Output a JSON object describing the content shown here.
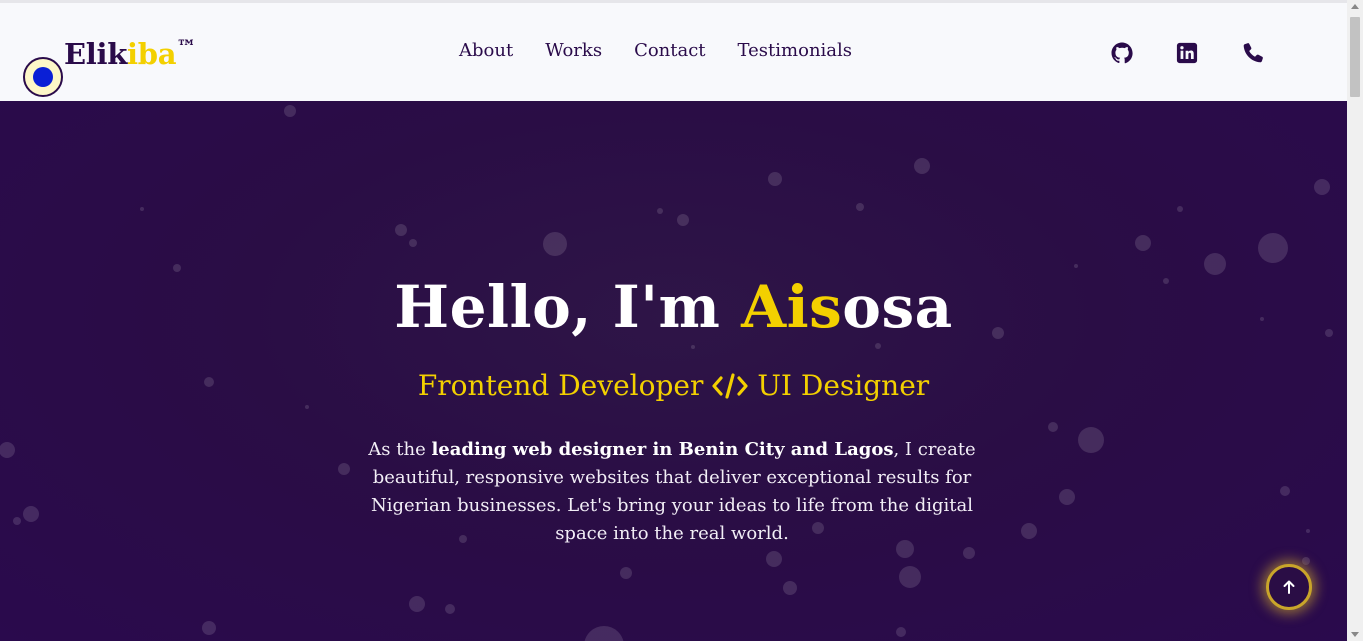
{
  "brand": {
    "name_part1": "Elik",
    "name_accent": "iba",
    "trademark": "™"
  },
  "nav": {
    "items": [
      {
        "label": "About"
      },
      {
        "label": "Works"
      },
      {
        "label": "Contact"
      },
      {
        "label": "Testimonials"
      }
    ]
  },
  "social": {
    "icons": [
      "github-icon",
      "linkedin-icon",
      "phone-icon"
    ]
  },
  "hero": {
    "greeting_prefix": "Hello, I'm ",
    "name_accent": "Ais",
    "name_rest": "osa",
    "role_left": "Frontend Developer",
    "role_icon": "code-icon",
    "role_right": "UI Designer",
    "intro_before": "As the ",
    "intro_bold": "leading web designer in Benin City and Lagos",
    "intro_after": ", I create beautiful, responsive websites that deliver exceptional results for Nigerian businesses. Let's bring your ideas to life from the digital space into the real world."
  },
  "colors": {
    "brand_dark": "#2a0b4a",
    "accent_yellow": "#f3d000",
    "hero_bg": "#2a0d45",
    "header_bg": "#f8f9fc"
  },
  "back_to_top": {
    "icon": "arrow-up-icon"
  }
}
